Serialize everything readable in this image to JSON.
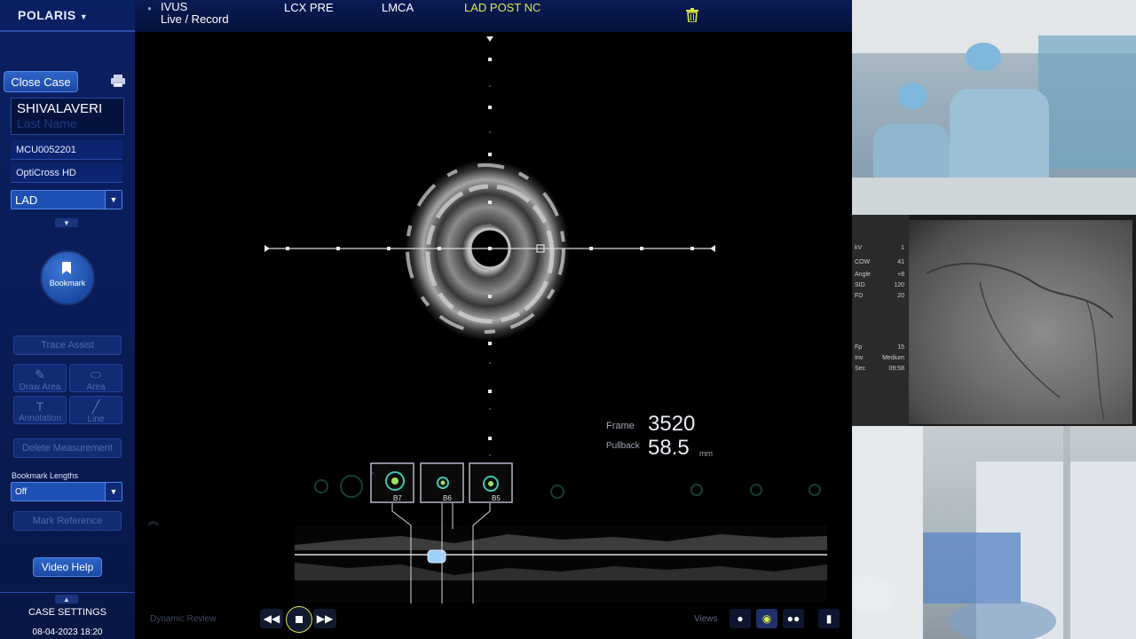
{
  "sidebar": {
    "brand": "POLARIS",
    "close_case": "Close Case",
    "patient_first": "SHIVALAVERI",
    "patient_last_placeholder": "Last Name",
    "patient_id": "MCU0052201",
    "catheter": "OptiCross HD",
    "vessel": "LAD",
    "bookmark": "Bookmark",
    "trace_assist": "Trace Assist",
    "draw_area": "Draw Area",
    "area": "Area",
    "annotation": "Annotation",
    "line": "Line",
    "delete_measurement": "Delete Measurement",
    "bookmark_lengths_label": "Bookmark Lengths",
    "bookmark_lengths_value": "Off",
    "mark_reference": "Mark Reference",
    "video_help": "Video Help",
    "case_settings": "CASE SETTINGS",
    "datetime": "08-04-2023 18:20"
  },
  "tabs": [
    {
      "label1": "IVUS",
      "label2": "Live / Record"
    },
    {
      "label": "LCX PRE"
    },
    {
      "label": "LMCA"
    },
    {
      "label": "LAD POST NC",
      "active": true
    }
  ],
  "ivus": {
    "frame_label": "Frame",
    "frame_value": "3520",
    "pullback_label": "Pullback",
    "pullback_value": "58.5",
    "pullback_unit": "mm",
    "bookmarks": [
      "B7",
      "B6",
      "B5"
    ],
    "dynamic_review": "Dynamic Review",
    "views_label": "Views"
  },
  "angio_panel": {
    "rows": [
      {
        "k": "kV",
        "v": "1"
      },
      {
        "k": "COW",
        "v": "41"
      },
      {
        "k": "Angle",
        "v": "+8"
      },
      {
        "k": "SID",
        "v": "120"
      },
      {
        "k": "FD",
        "v": "20"
      }
    ],
    "rows2": [
      {
        "k": "Fp",
        "v": "15"
      },
      {
        "k": "Inv",
        "v": "Medium"
      },
      {
        "k": "Sec",
        "v": "09:58"
      }
    ]
  },
  "icons": {
    "print": "printer-icon",
    "trash": "trash-icon",
    "bookmark": "bookmark-icon"
  },
  "colors": {
    "sidebar_bg": "#0b1f63",
    "active_tab": "#d9e84c",
    "button_blue": "#2f66c9"
  }
}
